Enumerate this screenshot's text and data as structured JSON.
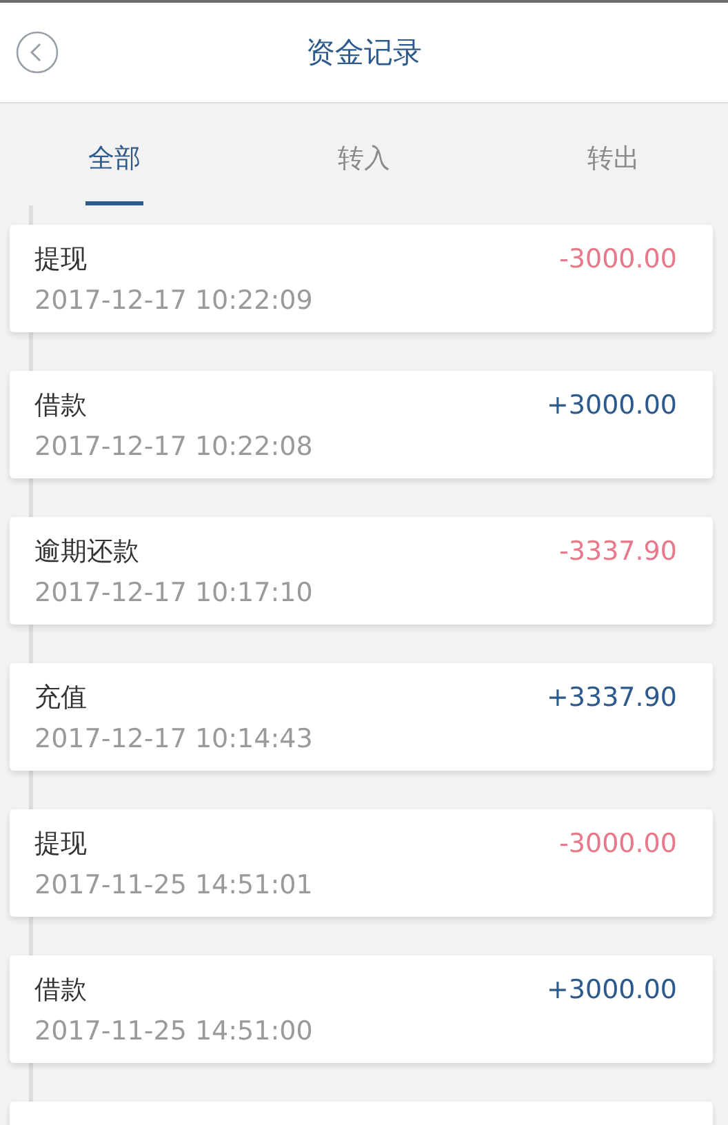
{
  "header": {
    "title": "资金记录"
  },
  "tabs": [
    {
      "label": "全部",
      "selected": true
    },
    {
      "label": "转入",
      "selected": false
    },
    {
      "label": "转出",
      "selected": false
    }
  ],
  "records": [
    {
      "name": "提现",
      "time": "2017-12-17 10:22:09",
      "amount": "-3000.00",
      "kind": "out"
    },
    {
      "name": "借款",
      "time": "2017-12-17 10:22:08",
      "amount": "+3000.00",
      "kind": "in"
    },
    {
      "name": "逾期还款",
      "time": "2017-12-17 10:17:10",
      "amount": "-3337.90",
      "kind": "out"
    },
    {
      "name": "充值",
      "time": "2017-12-17 10:14:43",
      "amount": "+3337.90",
      "kind": "in"
    },
    {
      "name": "提现",
      "time": "2017-11-25 14:51:01",
      "amount": "-3000.00",
      "kind": "out"
    },
    {
      "name": "借款",
      "time": "2017-11-25 14:51:00",
      "amount": "+3000.00",
      "kind": "in"
    }
  ]
}
